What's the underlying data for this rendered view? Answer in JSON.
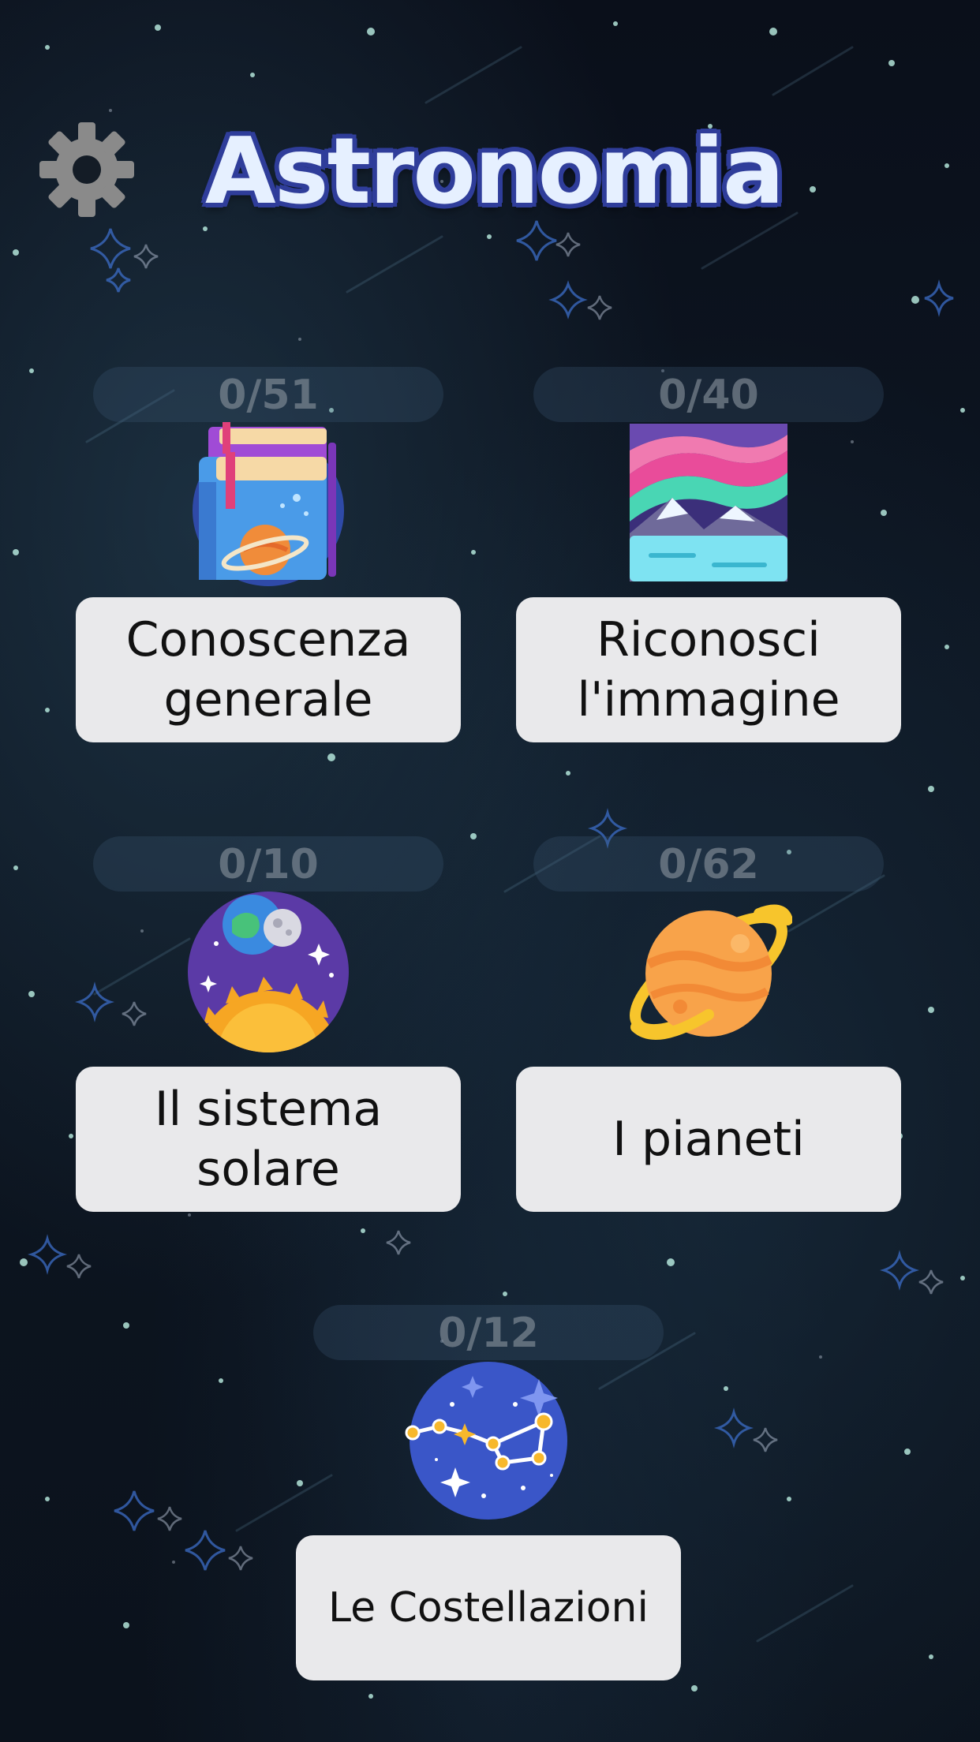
{
  "app": {
    "title": "Astronomia"
  },
  "header": {
    "settings_icon": "gear-icon"
  },
  "categories": [
    {
      "id": "general",
      "progress": "0/51",
      "label": "Conoscenza\ngenerale",
      "icon": "books-planet-icon"
    },
    {
      "id": "image",
      "progress": "0/40",
      "label": "Riconosci\nl'immagine",
      "icon": "aurora-landscape-icon"
    },
    {
      "id": "solar",
      "progress": "0/10",
      "label": "Il sistema\nsolare",
      "icon": "solar-system-icon"
    },
    {
      "id": "planets",
      "progress": "0/62",
      "label": "I pianeti",
      "icon": "ringed-planet-icon"
    },
    {
      "id": "constellations",
      "progress": "0/12",
      "label": "Le Costellazioni",
      "icon": "constellation-icon"
    }
  ],
  "colors": {
    "background": "#0b121c",
    "title_fill": "#e6f0ff",
    "title_outline": "#2f3d9a",
    "button_bg": "#e9e9eb",
    "progress_text": "#8c96a0",
    "gear": "#8a8a8a"
  }
}
